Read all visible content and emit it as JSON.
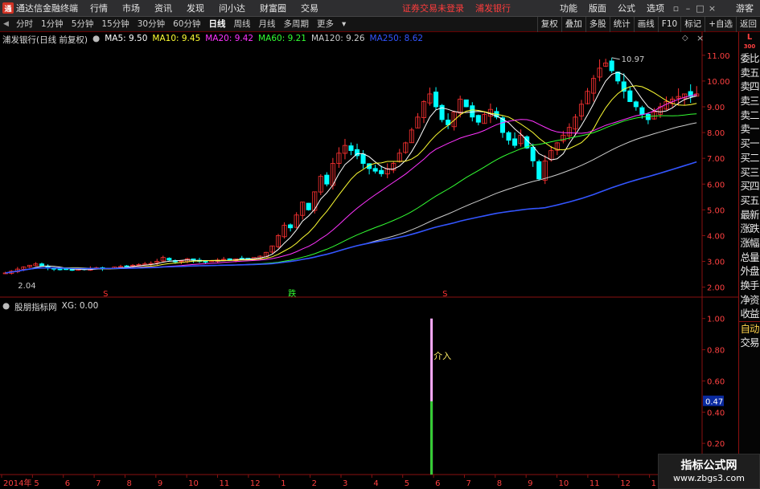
{
  "menubar": {
    "app_title": "通达信金融终端",
    "logo_glyph": "通",
    "items": [
      "行情",
      "市场",
      "资讯",
      "发现",
      "问小达",
      "财富圈",
      "交易"
    ],
    "notice": "证券交易未登录",
    "notice_stock": "浦发银行",
    "right_items": [
      "功能",
      "版面",
      "公式",
      "选项"
    ],
    "guest": "游客"
  },
  "toolbar": {
    "periods": [
      "分时",
      "1分钟",
      "5分钟",
      "15分钟",
      "30分钟",
      "60分钟",
      "日线",
      "周线",
      "月线",
      "多周期",
      "更多"
    ],
    "active_period": "日线",
    "tools": [
      "复权",
      "叠加",
      "多股",
      "统计",
      "画线",
      "F10",
      "标记",
      "+自选",
      "返回"
    ]
  },
  "main_header": {
    "title": "浦发银行(日线 前复权)",
    "ma": [
      {
        "label": "MA5: 9.50",
        "color": "#ffffff"
      },
      {
        "label": "MA10: 9.45",
        "color": "#ffff33"
      },
      {
        "label": "MA20: 9.42",
        "color": "#ff33ff"
      },
      {
        "label": "MA60: 9.21",
        "color": "#33ff33"
      },
      {
        "label": "MA120: 9.26",
        "color": "#cccccc"
      },
      {
        "label": "MA250: 8.62",
        "color": "#3355ff"
      }
    ]
  },
  "sub_header": {
    "title": "股朋指标网",
    "xg": "XG: 0.00"
  },
  "side_panel": {
    "badge_top": "L",
    "badge_bottom": "300",
    "items": [
      "委比",
      "卖五",
      "卖四",
      "卖三",
      "卖二",
      "卖一",
      "买一",
      "买二",
      "买三",
      "买四",
      "买五",
      "最新",
      "涨跌",
      "涨幅",
      "总量",
      "外盘",
      "换手",
      "净资",
      "收益"
    ],
    "auto": "自动",
    "trade": "交易"
  },
  "watermark": {
    "title": "指标公式网",
    "url": "www.zbgs3.com"
  },
  "colors": {
    "up": "#ff3232",
    "down": "#00ffff",
    "axis": "#8a1010",
    "axis_text": "#ff4040",
    "signal_bar": "#33cc33",
    "signal_top": "#ffaaff",
    "signal_label": "#ffee66"
  },
  "chart_data": {
    "type": "candlestick",
    "price_axis": {
      "ticks": [
        "11.00",
        "10.00",
        "9.00",
        "8.00",
        "7.00",
        "6.00",
        "5.00",
        "4.00",
        "3.00",
        "2.00"
      ],
      "min": 1.8,
      "max": 11.4
    },
    "annotations": {
      "high": "10.97",
      "low": "2.04"
    },
    "month_marks": [
      {
        "label": "S",
        "color": "#ff3232",
        "month_index": 3
      },
      {
        "label": "跌",
        "color": "#33ff33",
        "month_index": 9
      },
      {
        "label": "S",
        "color": "#ff3232",
        "month_index": 14
      }
    ],
    "sub_axis": {
      "ticks": [
        "1.00",
        "0.80",
        "0.60",
        "0.40",
        "0.20"
      ],
      "min": 0,
      "max": 1.05
    },
    "sub_value_label": "0.47",
    "signal": {
      "label": "介入",
      "value": 1.0
    },
    "x_labels": [
      "2014年",
      "5",
      "6",
      "7",
      "8",
      "9",
      "10",
      "11",
      "12",
      "1",
      "2",
      "3",
      "4",
      "5",
      "6",
      "7",
      "8",
      "9",
      "10",
      "11",
      "12",
      "1",
      "2"
    ],
    "close_series": [
      2.55,
      2.62,
      2.7,
      2.78,
      2.85,
      2.9,
      2.82,
      2.75,
      2.72,
      2.7,
      2.68,
      2.65,
      2.7,
      2.68,
      2.72,
      2.75,
      2.7,
      2.73,
      2.78,
      2.8,
      2.82,
      2.85,
      2.88,
      2.9,
      2.92,
      3.0,
      3.15,
      3.05,
      2.98,
      3.02,
      3.1,
      3.05,
      3.0,
      2.98,
      3.02,
      3.05,
      3.08,
      3.05,
      3.1,
      3.12,
      3.08,
      3.15,
      3.2,
      3.35,
      3.6,
      4.0,
      4.4,
      4.3,
      4.8,
      5.3,
      5.0,
      5.7,
      6.3,
      6.0,
      6.8,
      7.2,
      7.5,
      7.3,
      7.1,
      6.8,
      6.6,
      6.5,
      6.4,
      6.6,
      6.8,
      7.2,
      7.6,
      8.1,
      8.6,
      9.2,
      9.5,
      9.0,
      8.5,
      8.3,
      8.8,
      9.3,
      9.0,
      8.6,
      8.4,
      8.7,
      8.9,
      8.6,
      8.0,
      7.7,
      7.5,
      7.9,
      7.4,
      6.9,
      6.2,
      6.9,
      7.3,
      7.6,
      7.9,
      8.2,
      8.6,
      9.1,
      9.6,
      10.1,
      10.5,
      10.7,
      10.4,
      10.0,
      9.6,
      9.2,
      9.0,
      8.7,
      8.5,
      8.8,
      9.0,
      9.2,
      9.3,
      9.4,
      9.5,
      9.4,
      9.5
    ]
  }
}
